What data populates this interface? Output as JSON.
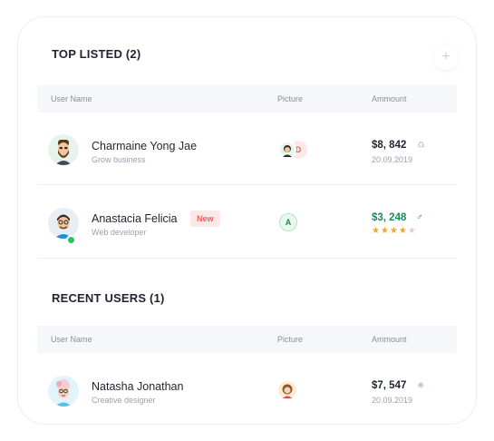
{
  "top_listed": {
    "title": "TOP LISTED (2)",
    "add_label": "+",
    "columns": {
      "user": "User Name",
      "picture": "Picture",
      "amount": "Ammount"
    },
    "rows": [
      {
        "name": "Charmaine Yong Jae",
        "role": "Grow business",
        "picture_letter": "D",
        "amount": "$8, 842",
        "date": "20.09.2019",
        "status_icon": "recycle-icon"
      },
      {
        "name": "Anastacia Felicia",
        "role": "Web developer",
        "badge": "New",
        "picture_letter": "A",
        "amount": "$3, 248",
        "amount_color": "#1b8a5a",
        "status_icon": "male-icon",
        "rating": 4,
        "rating_max": 5
      }
    ]
  },
  "recent_users": {
    "title": "RECENT USERS (1)",
    "columns": {
      "user": "User Name",
      "picture": "Picture",
      "amount": "Ammount"
    },
    "rows": [
      {
        "name": "Natasha Jonathan",
        "role": "Creative designer",
        "amount": "$7, 547",
        "date": "20.09.2019",
        "status_icon": "gear-icon"
      }
    ]
  },
  "colors": {
    "accent_green": "#1b8a5a",
    "new_badge": "#ef5f5f",
    "star": "#f5a623",
    "online": "#22c55e"
  }
}
